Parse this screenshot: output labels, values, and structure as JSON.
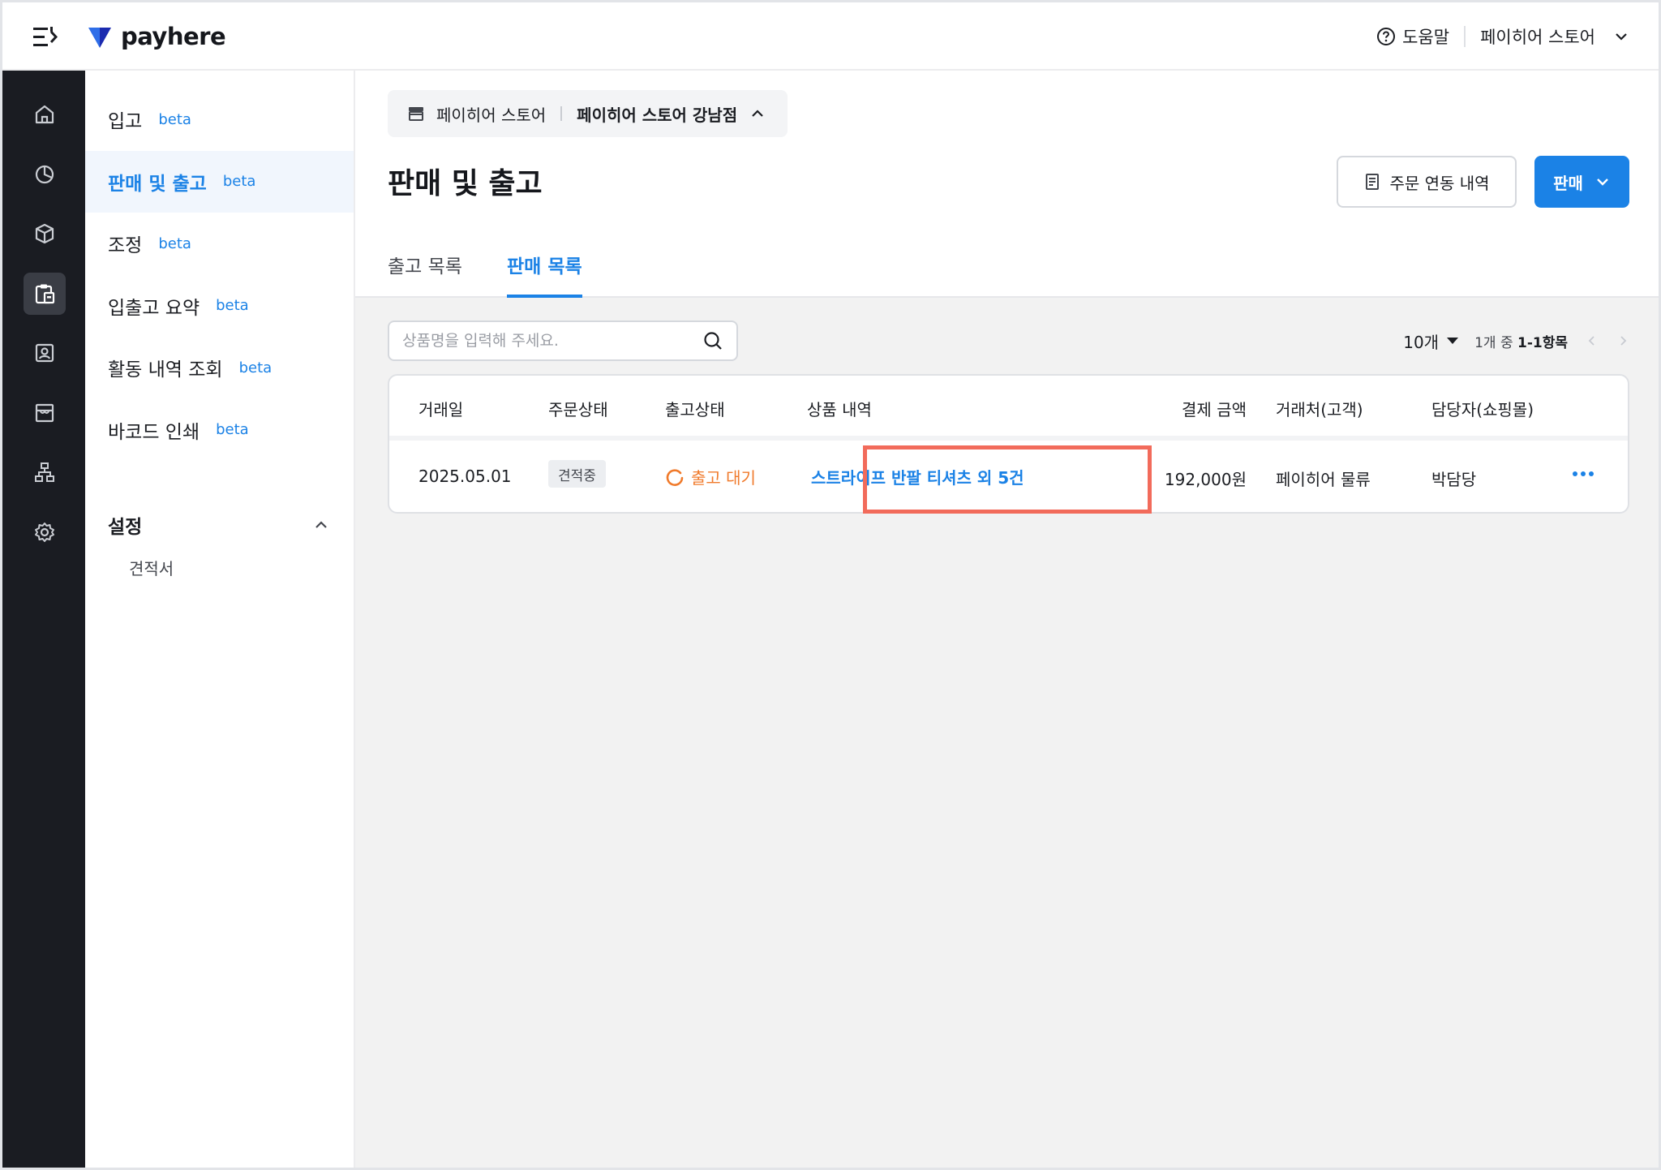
{
  "header": {
    "logo_text": "payhere",
    "help_label": "도움말",
    "store_name": "페이히어 스토어"
  },
  "rail": {
    "items": [
      "home-icon",
      "chart-icon",
      "box-icon",
      "clipboard-icon",
      "contact-icon",
      "store-icon",
      "org-icon",
      "gear-icon"
    ],
    "active_index": 3
  },
  "sidebar": {
    "items": [
      {
        "label": "입고",
        "badge": "beta"
      },
      {
        "label": "판매 및 출고",
        "badge": "beta"
      },
      {
        "label": "조정",
        "badge": "beta"
      },
      {
        "label": "입출고 요약",
        "badge": "beta"
      },
      {
        "label": "활동 내역 조회",
        "badge": "beta"
      },
      {
        "label": "바코드 인쇄",
        "badge": "beta"
      }
    ],
    "group_label": "설정",
    "sub_item": "견적서"
  },
  "main": {
    "store_pill": {
      "store": "페이히어 스토어",
      "branch": "페이히어 스토어 강남점"
    },
    "title": "판매 및 출고",
    "order_link_button": "주문 연동 내역",
    "sell_button": "판매",
    "tabs": [
      "출고 목록",
      "판매 목록"
    ],
    "active_tab": 1,
    "search_placeholder": "상품명을 입력해 주세요.",
    "page_size": "10개",
    "range_prefix": "1개 중",
    "range_value": "1-1항목"
  },
  "table": {
    "headers": [
      "거래일",
      "주문상태",
      "출고상태",
      "상품 내역",
      "결제 금액",
      "거래처(고객)",
      "담당자(쇼핑몰)"
    ],
    "rows": [
      {
        "date": "2025.05.01",
        "order_status": "견적중",
        "ship_status": "출고 대기",
        "product": "스트라이프 반팔 티셔츠 외 5건",
        "amount": "192,000원",
        "partner": "페이히어 물류",
        "manager": "박담당"
      }
    ]
  },
  "colors": {
    "accent": "#1b82e6",
    "rail_bg": "#1a1c22",
    "warning": "#f07a2b",
    "highlight": "#f26b5b"
  }
}
